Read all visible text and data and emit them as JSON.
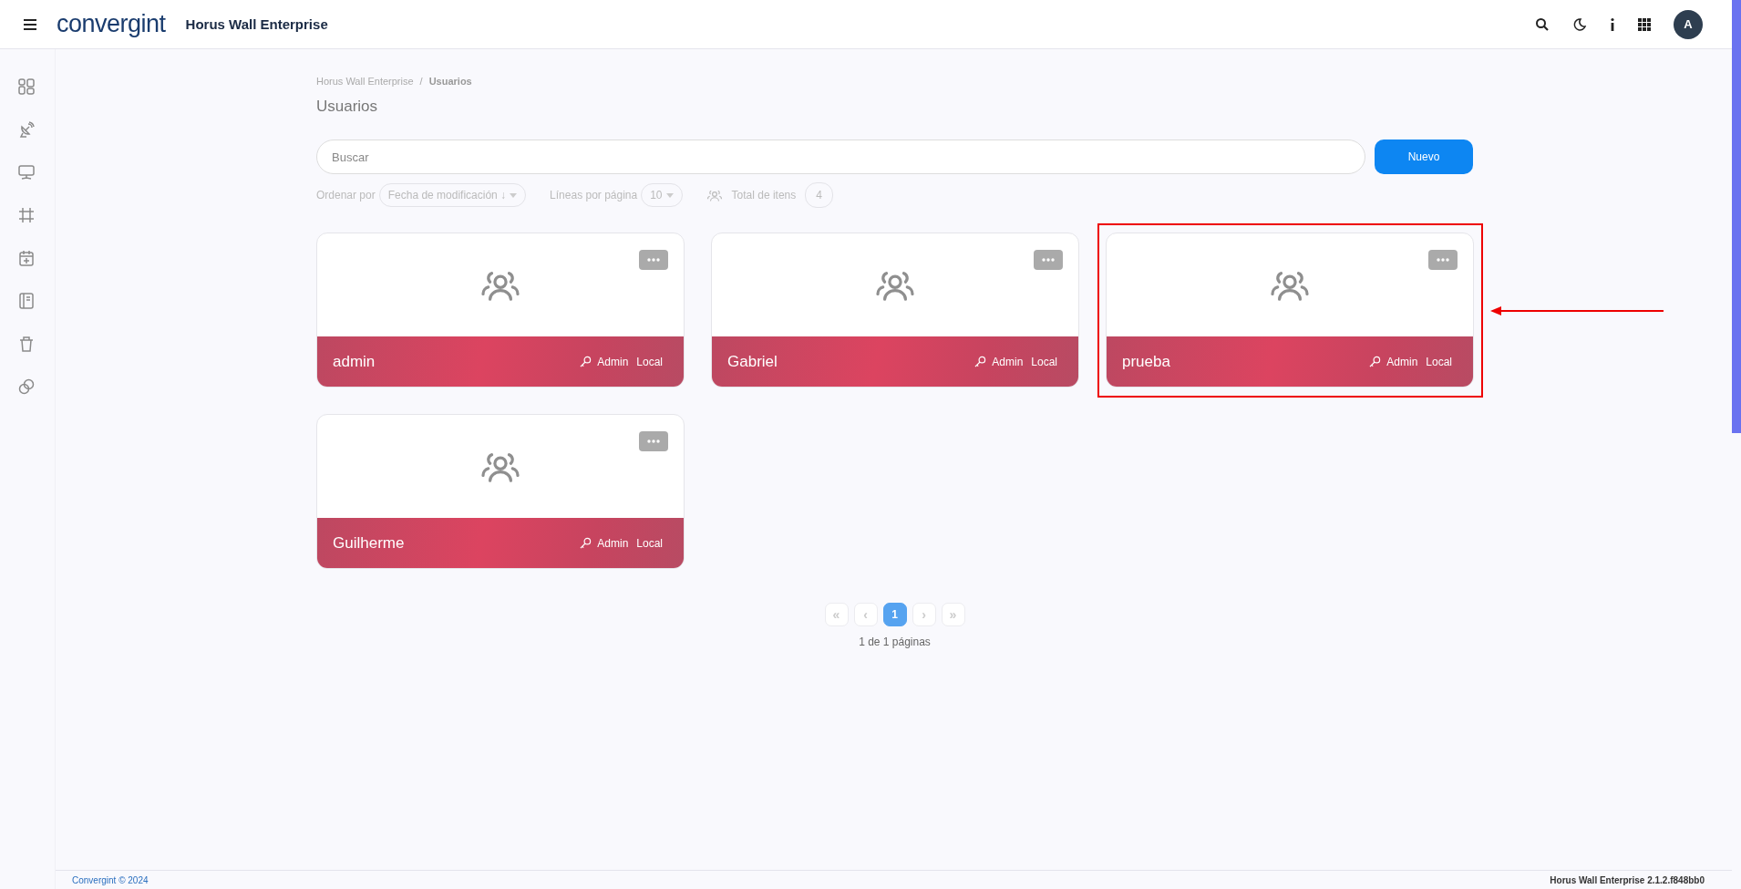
{
  "header": {
    "logo": "convergint",
    "app_title": "Horus Wall Enterprise",
    "avatar": "A"
  },
  "breadcrumb": [
    "Horus Wall Enterprise",
    "/",
    "Usuarios"
  ],
  "page_title": "Usuarios",
  "search": {
    "placeholder": "Buscar"
  },
  "new_button": "Nuevo",
  "filters": {
    "sort_label": "Ordenar por",
    "sort_value": "Fecha de modificación ↓",
    "lines_label": "Líneas por página",
    "lines_value": "10",
    "total_label": "Total de itens",
    "total_value": "4"
  },
  "users": [
    {
      "name": "admin",
      "role": "Admin",
      "source": "Local",
      "highlighted": false
    },
    {
      "name": "Gabriel",
      "role": "Admin",
      "source": "Local",
      "highlighted": false
    },
    {
      "name": "prueba",
      "role": "Admin",
      "source": "Local",
      "highlighted": true
    },
    {
      "name": "Guilherme",
      "role": "Admin",
      "source": "Local",
      "highlighted": false
    }
  ],
  "pagination": {
    "first": "«",
    "prev": "‹",
    "pages": [
      {
        "label": "1",
        "selected": true
      }
    ],
    "next": "›",
    "last": "»",
    "summary": "1 de 1 páginas"
  },
  "footer": {
    "left": "Convergint © 2024",
    "right": "Horus Wall Enterprise 2.1.2.f848bb0"
  }
}
